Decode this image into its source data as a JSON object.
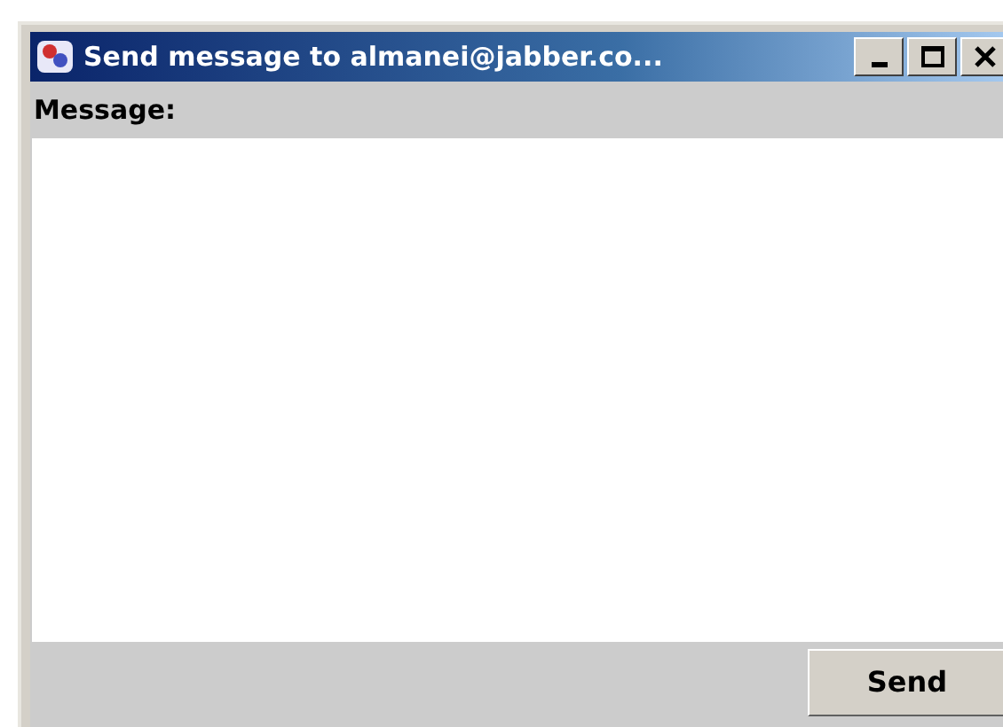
{
  "window": {
    "title": "Send message to almanei@jabber.co..."
  },
  "message": {
    "label": "Message:"
  },
  "buttons": [
    {
      "label": "Send"
    }
  ]
}
